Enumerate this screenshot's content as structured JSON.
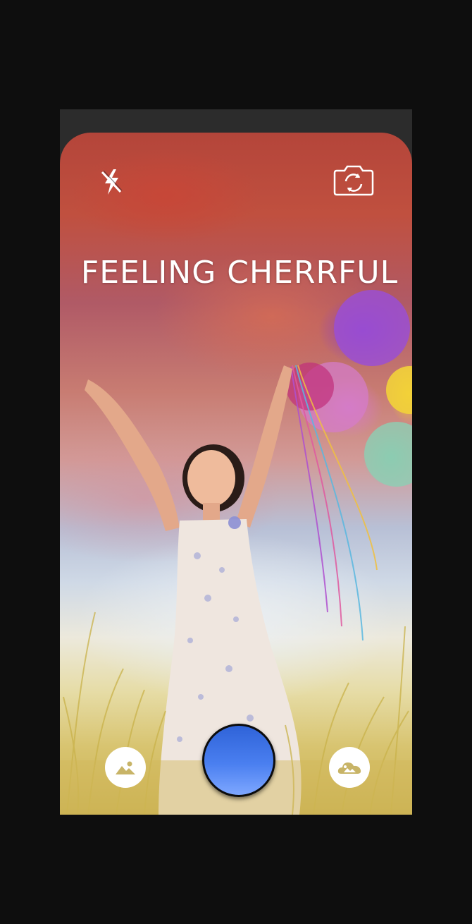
{
  "camera": {
    "mood_title": "FEELING CHERRFUL",
    "accent_color": "#3e73e8"
  },
  "controls": {
    "flash": {
      "icon": "flash-off-icon",
      "state": "off"
    },
    "switch_camera": {
      "icon": "camera-switch-icon"
    },
    "gallery": {
      "icon": "image-icon"
    },
    "shutter": {
      "icon": "shutter-button"
    },
    "filter": {
      "icon": "cloud-image-icon"
    }
  }
}
